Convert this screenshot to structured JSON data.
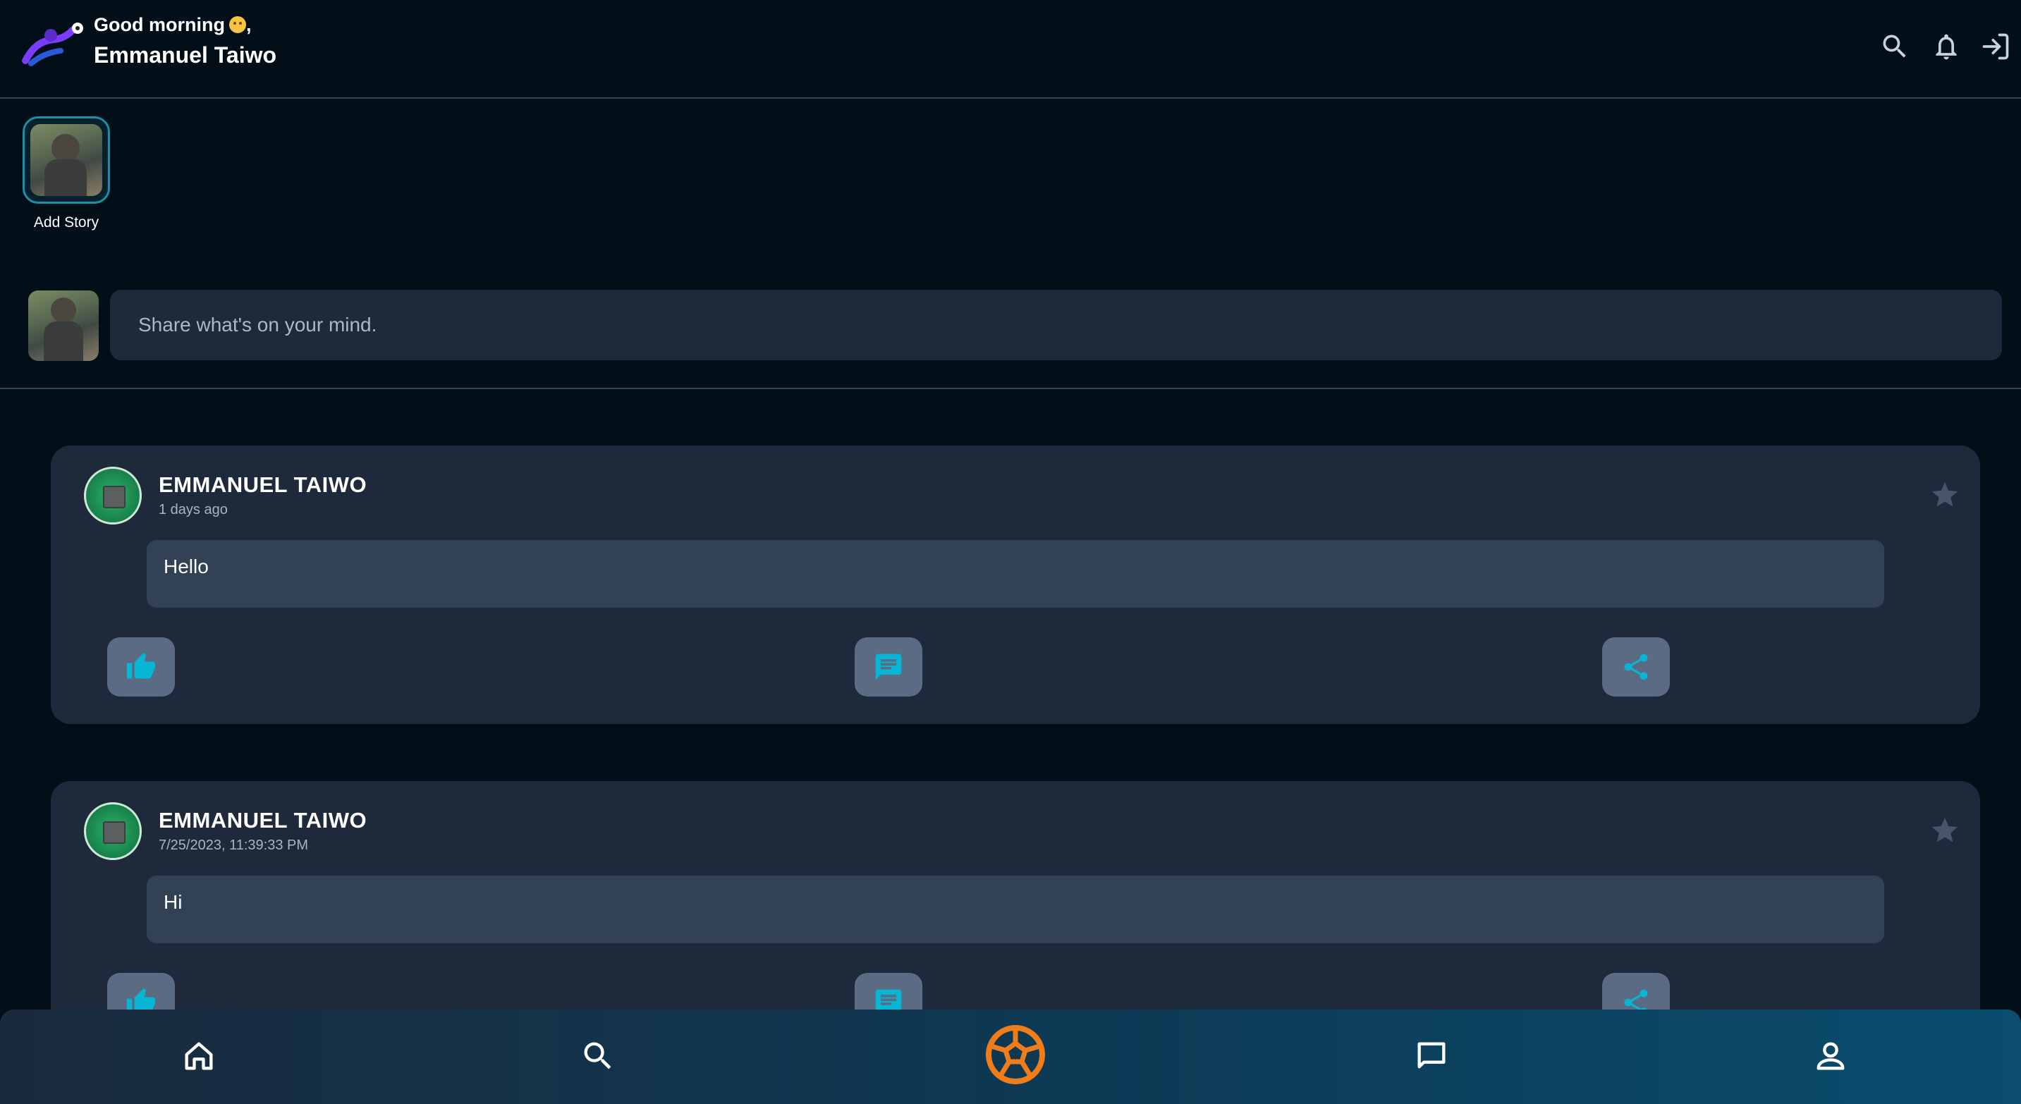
{
  "header": {
    "greeting": "Good morning",
    "greeting_suffix": ",",
    "user_name": "Emmanuel Taiwo",
    "icons": [
      "search-icon",
      "bell-icon",
      "logout-icon"
    ]
  },
  "stories": {
    "add_story_label": "Add Story"
  },
  "composer": {
    "placeholder": "Share what's on your mind."
  },
  "posts": [
    {
      "author": "EMMANUEL TAIWO",
      "time": "1 days ago",
      "body": "Hello"
    },
    {
      "author": "EMMANUEL TAIWO",
      "time": "7/25/2023, 11:39:33 PM",
      "body": "Hi"
    }
  ],
  "bottom_nav": {
    "items": [
      "home-icon",
      "search-icon",
      "football-icon",
      "chat-icon",
      "profile-icon"
    ]
  },
  "colors": {
    "background": "#020f19",
    "card": "#1e293b",
    "accent": "#06b6d4",
    "ball": "#f07d1a"
  }
}
